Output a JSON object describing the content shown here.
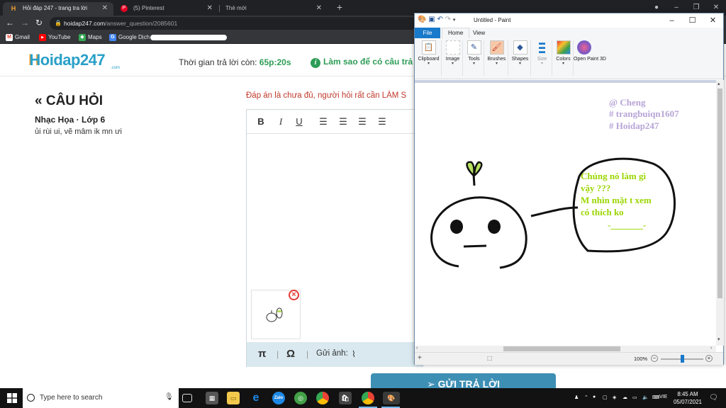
{
  "browser": {
    "tabs": [
      {
        "title": "Hỏi đáp 247 - trang tra lời",
        "active": true
      },
      {
        "title": "(5) Pinterest",
        "active": false
      },
      {
        "title": "Thẻ mới",
        "active": false
      }
    ],
    "address": {
      "host": "hoidap247.com",
      "path": "/answer_question/2085601"
    },
    "bookmarks": [
      "Gmail",
      "YouTube",
      "Maps",
      "Google Dịch"
    ]
  },
  "site": {
    "logo": "Hoidap247",
    "logo_sub": ".com",
    "timer_label": "Thời gian trả lời còn:",
    "timer_value": "65p:20s",
    "howto_link": "Làm sao để có câu trả",
    "question": {
      "heading": "CÂU HỎI",
      "subject": "Nhạc Họa · Lớp 6",
      "text": "ủi rùi ui, vẽ mâm ik mn ưi"
    },
    "answer_notice": "Đáp án là chưa đủ, người hỏi rất cần LÀM S",
    "editor": {
      "toolbar": [
        "B",
        "I",
        "U"
      ],
      "bottom_pi": "π",
      "bottom_omega": "Ω",
      "send_image_label": "Gửi ảnh:"
    },
    "submit_label": "GỬI TRẢ LỜI"
  },
  "paint": {
    "title": "Untitled - Paint",
    "menu": {
      "file": "File",
      "home": "Home",
      "view": "View"
    },
    "ribbon": [
      {
        "label": "Clipboard",
        "icon": "clipboard-icon",
        "disabled": false
      },
      {
        "label": "Image",
        "icon": "image-select-icon",
        "disabled": false
      },
      {
        "label": "Tools",
        "icon": "tools-icon",
        "disabled": false
      },
      {
        "label": "Brushes",
        "icon": "brush-icon",
        "disabled": false
      },
      {
        "label": "Shapes",
        "icon": "shapes-icon",
        "disabled": false
      },
      {
        "label": "Size",
        "icon": "size-icon",
        "disabled": true
      },
      {
        "label": "Colors",
        "icon": "colors-icon",
        "disabled": false
      },
      {
        "label": "Open Paint 3D",
        "icon": "paint3d-icon",
        "disabled": false
      }
    ],
    "canvas": {
      "credit_lines": [
        "@ Cheng",
        "# trangbuiqn1607",
        "# Hoidap247"
      ],
      "speech_lines": [
        "Chúng nó làm gì",
        "vậy ???",
        "M nhìn mặt t xem",
        "có thích ko",
        "-_______-"
      ]
    },
    "zoom": "100%",
    "zoom_level": 0.5
  },
  "taskbar": {
    "search_placeholder": "Type here to search",
    "lang": "VIE",
    "time": "8:45 AM",
    "date": "05/07/2021"
  },
  "colors": {
    "brand": "#2aa0c8",
    "timer_green": "#2e9d56",
    "notice_red": "#c0392b",
    "paint_file_blue": "#1979ca",
    "drawing_text": "#b7a4d6",
    "speech_text": "#9bd600"
  }
}
